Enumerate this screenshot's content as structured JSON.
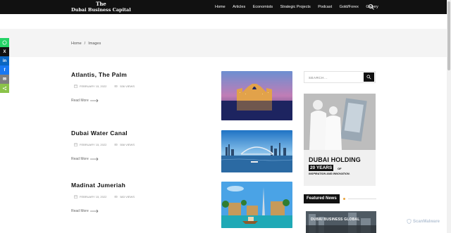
{
  "site": {
    "logo_line1": "The",
    "logo_line2": "Dubai Business Capital"
  },
  "nav": {
    "items": [
      "Home",
      "Articles",
      "Economists",
      "Strategic Projects",
      "Podcast",
      "Gold/Forex",
      "Gallery"
    ]
  },
  "social": [
    {
      "icon": "whatsapp-icon",
      "glyph": "●",
      "color": "#25d366"
    },
    {
      "icon": "x-twitter-icon",
      "glyph": "X",
      "color": "#111111"
    },
    {
      "icon": "linkedin-icon",
      "glyph": "in",
      "color": "#0a66c2"
    },
    {
      "icon": "facebook-icon",
      "glyph": "f",
      "color": "#1877f2"
    },
    {
      "icon": "email-icon",
      "glyph": "✉",
      "color": "#7f7f7f"
    },
    {
      "icon": "share-icon",
      "glyph": "<",
      "color": "#8bc34a"
    }
  ],
  "breadcrumb": {
    "home": "Home",
    "separator": "/",
    "current": "Images"
  },
  "articles": [
    {
      "title": "Atlantis, The Palm",
      "date": "FEBRUARY 15, 2022",
      "views": "536 VIEWS",
      "more": "Read More"
    },
    {
      "title": "Dubai Water Canal",
      "date": "FEBRUARY 15, 2022",
      "views": "558 VIEWS",
      "more": "Read More"
    },
    {
      "title": "Madinat Jumeriah",
      "date": "FEBRUARY 15, 2022",
      "views": "583 VIEWS",
      "more": "Read More"
    }
  ],
  "sidebar": {
    "search_placeholder": "SEARCH...",
    "ad": {
      "title": "DUBAI HOLDING",
      "years": "20 YEARS",
      "of": "OF",
      "tagline": "INSPIRATION AND INNOVATION."
    },
    "featured_label": "Featured News",
    "featured_card": "DUBAI BUSINESS GLOBAL"
  },
  "watermark": "ScanMalware",
  "colors": {
    "topbar": "#111111",
    "accent": "#e8a33d"
  }
}
